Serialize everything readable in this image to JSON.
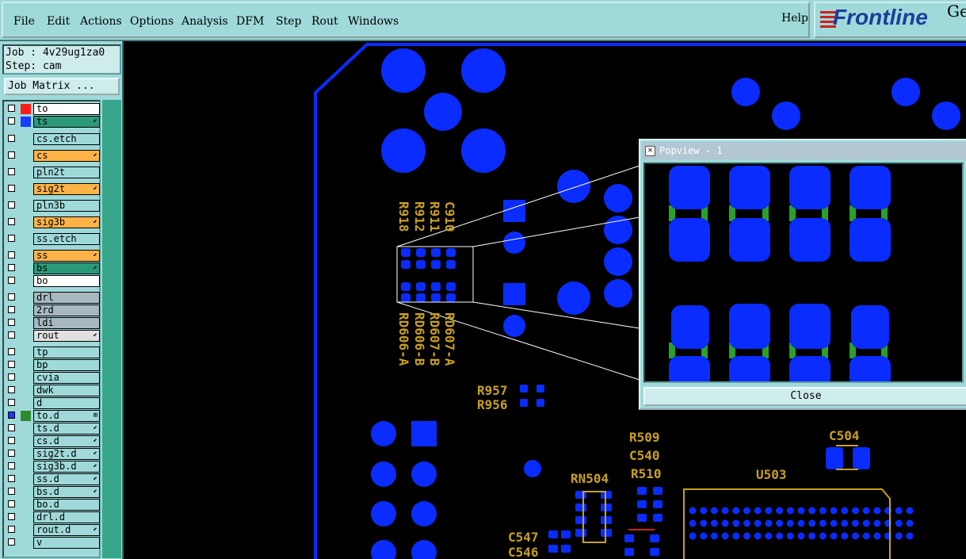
{
  "menu": {
    "items": [
      "File",
      "Edit",
      "Actions",
      "Options",
      "Analysis",
      "DFM",
      "Step",
      "Rout",
      "Windows"
    ],
    "help": "Help"
  },
  "logo": {
    "text": "Frontline",
    "suffix": "Ge"
  },
  "job": {
    "job_line": "Job : 4v29ug1za0",
    "step_line": "Step: cam",
    "matrix_button": "Job Matrix ..."
  },
  "layers": [
    {
      "name": "to",
      "color": "#ff1a1a",
      "bg": "#ffffff",
      "mark": ""
    },
    {
      "name": "ts",
      "color": "#1a3cff",
      "bg": "#2a9a7a",
      "mark": "⬋"
    },
    {
      "name": "cs.etch",
      "color": "",
      "bg": "#9fd9d9",
      "mark": ""
    },
    {
      "name": "cs",
      "color": "",
      "bg": "#ffb347",
      "mark": "⬋"
    },
    {
      "name": "pln2t",
      "color": "",
      "bg": "#9fd9d9",
      "mark": ""
    },
    {
      "name": "sig2t",
      "color": "",
      "bg": "#ffb347",
      "mark": "⬋"
    },
    {
      "name": "pln3b",
      "color": "",
      "bg": "#9fd9d9",
      "mark": ""
    },
    {
      "name": "sig3b",
      "color": "",
      "bg": "#ffb347",
      "mark": "⬋"
    },
    {
      "name": "ss.etch",
      "color": "",
      "bg": "#9fd9d9",
      "mark": ""
    },
    {
      "name": "ss",
      "color": "",
      "bg": "#ffb347",
      "mark": "⬋"
    },
    {
      "name": "bs",
      "color": "",
      "bg": "#2a9a7a",
      "mark": "⬋"
    },
    {
      "name": "bo",
      "color": "",
      "bg": "#ffffff",
      "mark": ""
    },
    {
      "name": "drl",
      "color": "",
      "bg": "#a8b8c0",
      "mark": ""
    },
    {
      "name": "2rd",
      "color": "",
      "bg": "#a8b8c0",
      "mark": ""
    },
    {
      "name": "ldi",
      "color": "",
      "bg": "#a8b8c0",
      "mark": ""
    },
    {
      "name": "rout",
      "color": "",
      "bg": "#e0e0e0",
      "mark": "⬋"
    },
    {
      "name": "tp",
      "color": "",
      "bg": "#9fd9d9",
      "mark": ""
    },
    {
      "name": "bp",
      "color": "",
      "bg": "#9fd9d9",
      "mark": ""
    },
    {
      "name": "cvia",
      "color": "",
      "bg": "#9fd9d9",
      "mark": ""
    },
    {
      "name": "dwk",
      "color": "",
      "bg": "#9fd9d9",
      "mark": ""
    },
    {
      "name": "d",
      "color": "",
      "bg": "#9fd9d9",
      "mark": ""
    },
    {
      "name": "to.d",
      "color": "#2e8b2e",
      "bg": "#9fd9d9",
      "mark": "⊞"
    },
    {
      "name": "ts.d",
      "color": "",
      "bg": "#9fd9d9",
      "mark": "⬋"
    },
    {
      "name": "cs.d",
      "color": "",
      "bg": "#9fd9d9",
      "mark": "⬋"
    },
    {
      "name": "sig2t.d",
      "color": "",
      "bg": "#9fd9d9",
      "mark": "⬋"
    },
    {
      "name": "sig3b.d",
      "color": "",
      "bg": "#9fd9d9",
      "mark": "⬋"
    },
    {
      "name": "ss.d",
      "color": "",
      "bg": "#9fd9d9",
      "mark": "⬋"
    },
    {
      "name": "bs.d",
      "color": "",
      "bg": "#9fd9d9",
      "mark": "⬋"
    },
    {
      "name": "bo.d",
      "color": "",
      "bg": "#9fd9d9",
      "mark": ""
    },
    {
      "name": "drl.d",
      "color": "",
      "bg": "#9fd9d9",
      "mark": ""
    },
    {
      "name": "rout.d",
      "color": "",
      "bg": "#9fd9d9",
      "mark": "⬋"
    },
    {
      "name": "v",
      "color": "",
      "bg": "#9fd9d9",
      "mark": ""
    }
  ],
  "board_labels": {
    "c910": "C910",
    "r911": "R911",
    "r912": "R912",
    "r918": "R918",
    "rd607a": "RD607-A",
    "rd607b": "RD607-B",
    "rd606b": "RD606-B",
    "rd606a": "RD606-A",
    "r957": "R957",
    "r956": "R956",
    "r509": "R509",
    "c540": "C540",
    "r510": "R510",
    "c504": "C504",
    "rn504": "RN504",
    "u503": "U503",
    "c547": "C547",
    "c546": "C546"
  },
  "popup": {
    "title": "Popview - 1",
    "close": "Close"
  },
  "colors": {
    "pad": "#0a2cff",
    "silk": "#c8a020",
    "panel": "#9fd9d9"
  }
}
